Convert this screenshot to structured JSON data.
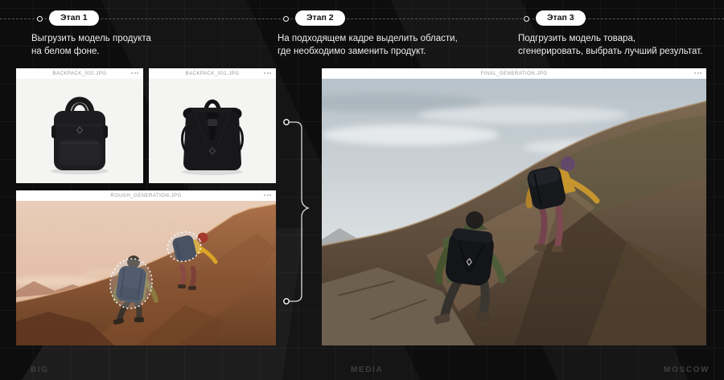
{
  "stages": [
    {
      "badge": "Этап 1",
      "line1": "Выгрузить модель продукта",
      "line2": "на белом фоне."
    },
    {
      "badge": "Этап 2",
      "line1": "На подходящем кадре выделить области,",
      "line2": "где необходимо заменить продукт."
    },
    {
      "badge": "Этап 3",
      "line1": "Подгрузить модель товара,",
      "line2": "сгенерировать, выбрать лучший результат."
    }
  ],
  "cards": [
    {
      "filename": "BACKPACK_002.JPG"
    },
    {
      "filename": "BACKPACK_001.JPG"
    },
    {
      "filename": "ROUGH_GENERATION.JPG"
    },
    {
      "filename": "FINAL_GENERATION.JPG"
    }
  ],
  "footer": {
    "left": "BIG",
    "center": "MEDIA",
    "right": "MOSCOW"
  },
  "colors": {
    "background": "#0d0d0d",
    "badge_bg": "#ffffff",
    "badge_text": "#0f0f0f",
    "text_primary": "#ededed",
    "timeline_line": "#565656",
    "card_header_bg": "#ffffff",
    "filename_text": "#979797",
    "footer_text": "#3e3e3e",
    "selection_dash": "#ffffff"
  }
}
